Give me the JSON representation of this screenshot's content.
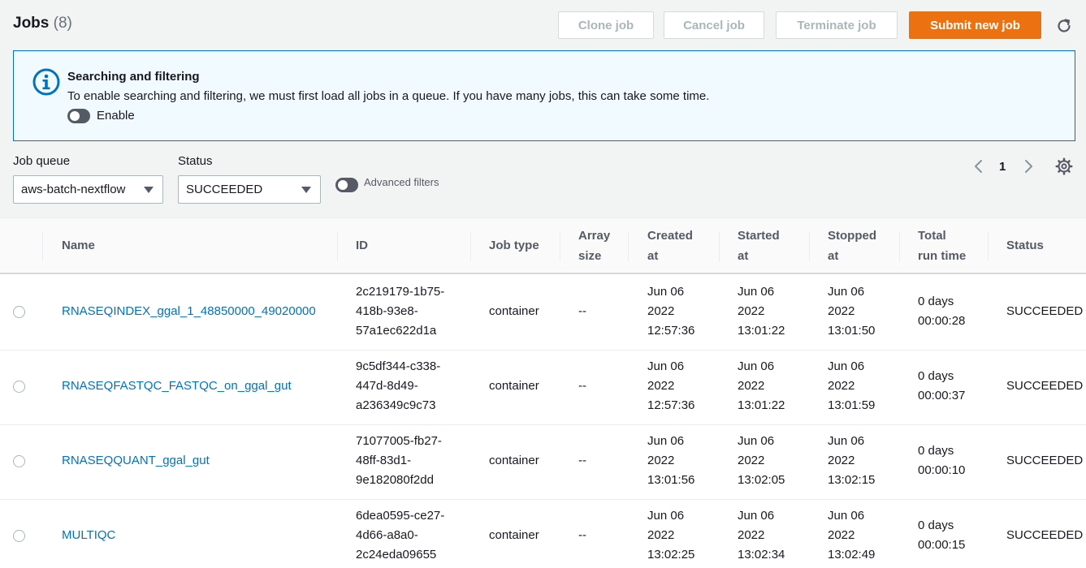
{
  "header": {
    "title": "Jobs",
    "count": "(8)",
    "buttons": {
      "clone": "Clone job",
      "cancel": "Cancel job",
      "terminate": "Terminate job",
      "submit": "Submit new job"
    },
    "refresh_icon": "refresh-icon"
  },
  "alert": {
    "title": "Searching and filtering",
    "text": "To enable searching and filtering, we must first load all jobs in a queue. If you have many jobs, this can take some time.",
    "toggle_label": "Enable",
    "icon": "info-icon"
  },
  "filters": {
    "job_queue_label": "Job queue",
    "job_queue_value": "aws-batch-nextflow",
    "status_label": "Status",
    "status_value": "SUCCEEDED",
    "advanced_label": "Advanced filters"
  },
  "pagination": {
    "page": "1"
  },
  "table": {
    "headers": {
      "name": "Name",
      "id": "ID",
      "job_type": "Job type",
      "array_size": "Array\nsize",
      "created_at": "Created\nat",
      "started_at": "Started\nat",
      "stopped_at": "Stopped\nat",
      "total_run_time": "Total\nrun time",
      "status": "Status"
    },
    "rows": [
      {
        "name": "RNASEQINDEX_ggal_1_48850000_49020000",
        "id": "2c219179-1b75-\n418b-93e8-\n57a1ec622d1a",
        "job_type": "container",
        "array_size": "--",
        "created_at": "Jun 06\n2022\n12:57:36",
        "started_at": "Jun 06\n2022\n13:01:22",
        "stopped_at": "Jun 06\n2022\n13:01:50",
        "total_run_time": "0 days\n00:00:28",
        "status": "SUCCEEDED"
      },
      {
        "name": "RNASEQFASTQC_FASTQC_on_ggal_gut",
        "id": "9c5df344-c338-\n447d-8d49-\na236349c9c73",
        "job_type": "container",
        "array_size": "--",
        "created_at": "Jun 06\n2022\n12:57:36",
        "started_at": "Jun 06\n2022\n13:01:22",
        "stopped_at": "Jun 06\n2022\n13:01:59",
        "total_run_time": "0 days\n00:00:37",
        "status": "SUCCEEDED"
      },
      {
        "name": "RNASEQQUANT_ggal_gut",
        "id": "71077005-fb27-\n48ff-83d1-\n9e182080f2dd",
        "job_type": "container",
        "array_size": "--",
        "created_at": "Jun 06\n2022\n13:01:56",
        "started_at": "Jun 06\n2022\n13:02:05",
        "stopped_at": "Jun 06\n2022\n13:02:15",
        "total_run_time": "0 days\n00:00:10",
        "status": "SUCCEEDED"
      },
      {
        "name": "MULTIQC",
        "id": "6dea0595-ce27-\n4d66-a8a0-\n2c24eda09655",
        "job_type": "container",
        "array_size": "--",
        "created_at": "Jun 06\n2022\n13:02:25",
        "started_at": "Jun 06\n2022\n13:02:34",
        "stopped_at": "Jun 06\n2022\n13:02:49",
        "total_run_time": "0 days\n00:00:15",
        "status": "SUCCEEDED"
      }
    ]
  },
  "colors": {
    "primary": "#ec7211",
    "link": "#0073bb",
    "info_border": "#0073bb",
    "info_bg": "#f1faff"
  }
}
